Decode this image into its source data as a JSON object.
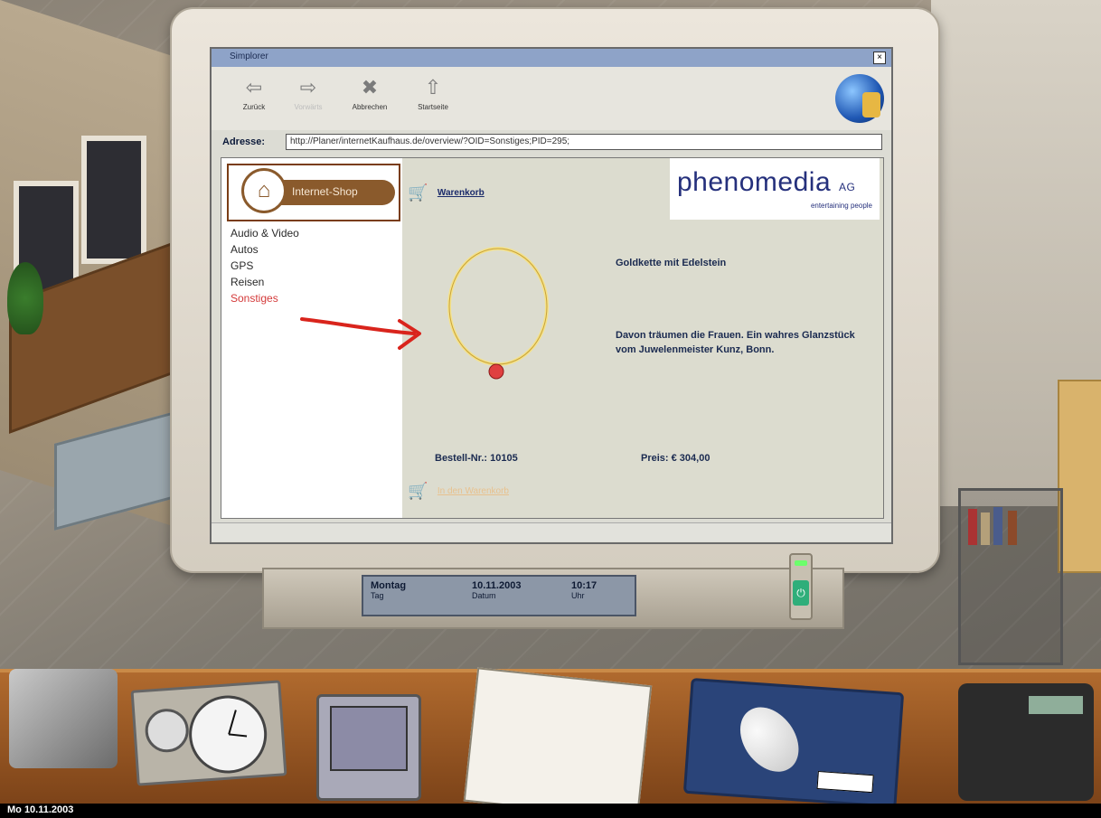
{
  "taskbar": {
    "date": "Mo 10.11.2003"
  },
  "monitor_display": {
    "day": "Montag",
    "day_label": "Tag",
    "date": "10.11.2003",
    "date_label": "Datum",
    "time": "10:17",
    "time_label": "Uhr"
  },
  "browser": {
    "title": "Simplorer",
    "toolbar": {
      "back": "Zurück",
      "forward": "Vorwärts",
      "stop": "Abbrechen",
      "home": "Startseite"
    },
    "address_label": "Adresse:",
    "address_value": "http://Planer/internetKaufhaus.de/overview/?OID=Sonstiges;PID=295;"
  },
  "shop": {
    "banner": "Internet-Shop",
    "categories": [
      {
        "label": "Audio & Video"
      },
      {
        "label": "Autos"
      },
      {
        "label": "GPS"
      },
      {
        "label": "Reisen"
      },
      {
        "label": "Sonstiges",
        "active": true
      }
    ],
    "cart_link": "Warenkorb",
    "sponsor": {
      "name": "phenomedia",
      "suffix": "AG",
      "tagline": "entertaining people"
    },
    "product": {
      "title": "Goldkette mit Edelstein",
      "description": "Davon träumen die Frauen. Ein wahres Glanzstück vom Juwelenmeister Kunz, Bonn.",
      "order_no": "Bestell-Nr.: 10105",
      "price": "Preis: € 304,00",
      "add_to_cart": "In den Warenkorb"
    }
  },
  "colors": {
    "active_category": "#d43a3a",
    "annotation_arrow": "#d9241c",
    "sponsor": "#25307c"
  }
}
